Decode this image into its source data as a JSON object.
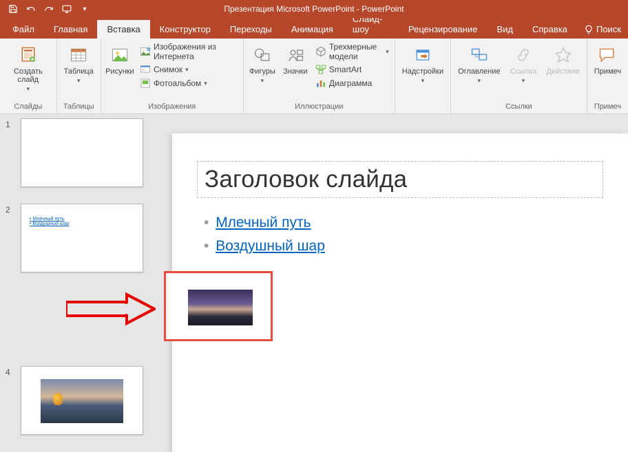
{
  "titlebar": {
    "title": "Презентация Microsoft PowerPoint  -  PowerPoint"
  },
  "qat": {
    "save": "save-icon",
    "undo": "undo-icon",
    "redo": "redo-icon",
    "start": "start-from-beginning-icon",
    "customize": "▾"
  },
  "tabs": {
    "file": "Файл",
    "home": "Главная",
    "insert": "Вставка",
    "design": "Конструктор",
    "transitions": "Переходы",
    "animations": "Анимация",
    "slideshow": "Слайд-шоу",
    "review": "Рецензирование",
    "view": "Вид",
    "help": "Справка",
    "search": "Поиск"
  },
  "ribbon": {
    "slides_group": "Слайды",
    "new_slide": "Создать слайд",
    "tables_group": "Таблицы",
    "table": "Таблица",
    "images_group": "Изображения",
    "pictures": "Рисунки",
    "online_pictures": "Изображения из Интернета",
    "screenshot": "Снимок",
    "photo_album": "Фотоальбом",
    "illustrations_group": "Иллюстрации",
    "shapes": "Фигуры",
    "icons": "Значки",
    "models_3d": "Трехмерные модели",
    "smartart": "SmartArt",
    "chart": "Диаграмма",
    "addins": "Надстройки",
    "links_group": "Ссылки",
    "zoom": "Оглавление",
    "link": "Ссылка",
    "action": "Действие",
    "comments": "Примеч"
  },
  "thumbs": {
    "n1": "1",
    "n2": "2",
    "n4": "4",
    "link1": "Млечный путь",
    "link2": "Воздушный шар"
  },
  "slide": {
    "title": "Заголовок слайда",
    "bullet1": "Млечный путь",
    "bullet2": "Воздушный шар"
  }
}
